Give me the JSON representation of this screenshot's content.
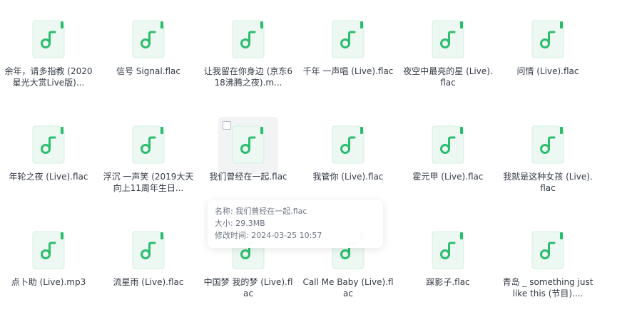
{
  "colors": {
    "icon_accent": "#2bbd6e",
    "icon_bg": "#ecf8f1",
    "icon_border": "#d3efe0",
    "text": "#333a45",
    "hover_bg": "#f2f3f5"
  },
  "file_icon": "music-file-icon",
  "files": [
    {
      "name": "余年，请多指教 (2020星光大赏Live版)..."
    },
    {
      "name": "信号 Signal.flac"
    },
    {
      "name": "让我留在你身边 (京东618沸腾之夜).m..."
    },
    {
      "name": "千年 一声唱 (Live).flac"
    },
    {
      "name": "夜空中最亮的星 (Live).flac"
    },
    {
      "name": "问情 (Live).flac"
    },
    {
      "name": "年轮之夜 (Live).flac"
    },
    {
      "name": "浮沉 一声笑 (2019大天向上11周年生日..."
    },
    {
      "name": "我们曾经在一起.flac"
    },
    {
      "name": "我管你 (Live).flac"
    },
    {
      "name": "霍元甲 (Live).flac"
    },
    {
      "name": "我就是这种女孩 (Live).flac"
    },
    {
      "name": "点卜助 (Live).mp3"
    },
    {
      "name": "流星雨 (Live).flac"
    },
    {
      "name": "中国梦 我的梦 (Live).flac"
    },
    {
      "name": "Call Me Baby (Live).flac"
    },
    {
      "name": "踩影子.flac"
    },
    {
      "name": "青岛 _ something just like this (节目)...."
    }
  ],
  "tooltip": {
    "name_line": "名称: 我们曾经在一起.flac",
    "size_line": "大小: 29.3MB",
    "modified_line": "修改时间: 2024-03-25 10:57"
  }
}
